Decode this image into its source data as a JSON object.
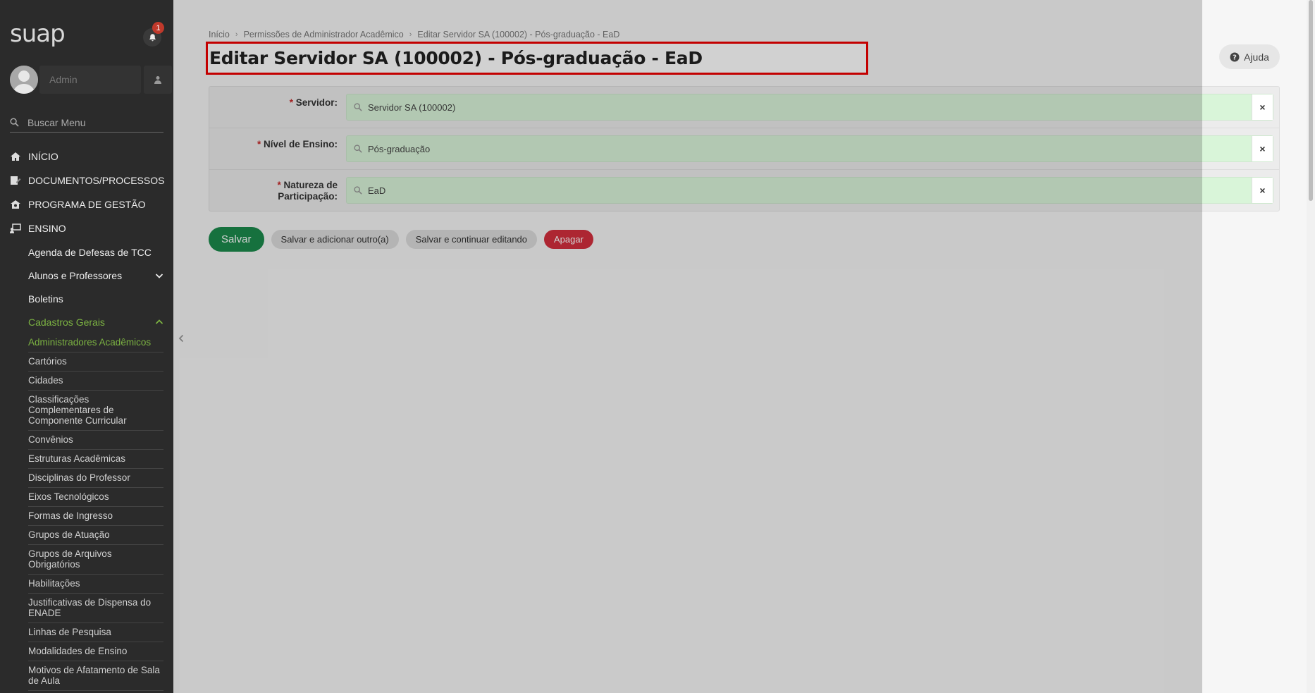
{
  "sidebar": {
    "logo": "suap",
    "notification_count": "1",
    "user_name": "Admin",
    "search_placeholder": "Buscar Menu",
    "top_items": [
      {
        "label": "INÍCIO",
        "icon": "home-icon"
      },
      {
        "label": "DOCUMENTOS/PROCESSOS",
        "icon": "document-edit-icon"
      },
      {
        "label": "PROGRAMA DE GESTÃO",
        "icon": "management-icon"
      },
      {
        "label": "ENSINO",
        "icon": "teaching-icon"
      }
    ],
    "ensino_items": [
      "Agenda de Defesas de TCC",
      "Alunos e Professores",
      "Boletins",
      "Cadastros Gerais"
    ],
    "cadastros_items": [
      "Administradores Acadêmicos",
      "Cartórios",
      "Cidades",
      "Classificações Complementares de Componente Curricular",
      "Convênios",
      "Estruturas Acadêmicas",
      "Disciplinas do Professor",
      "Eixos Tecnológicos",
      "Formas de Ingresso",
      "Grupos de Atuação",
      "Grupos de Arquivos Obrigatórios",
      "Habilitações",
      "Justificativas de Dispensa do ENADE",
      "Linhas de Pesquisa",
      "Modalidades de Ensino",
      "Motivos de Afatamento de Sala de Aula"
    ]
  },
  "breadcrumb": [
    "Início",
    "Permissões de Administrador Acadêmico",
    "Editar Servidor SA (100002) - Pós-graduação - EaD"
  ],
  "page_title": "Editar Servidor SA (100002) - Pós-graduação - EaD",
  "help_label": "Ajuda",
  "form": {
    "required_mark": "*",
    "servidor_label": "Servidor:",
    "servidor_value": "Servidor SA (100002)",
    "nivel_label": "Nível de Ensino:",
    "nivel_value": "Pós-graduação",
    "natureza_label_1": "Natureza de",
    "natureza_label_2": "Participação:",
    "natureza_value": "EaD",
    "clear_symbol": "×"
  },
  "actions": {
    "save": "Salvar",
    "save_add": "Salvar e adicionar outro(a)",
    "save_continue": "Salvar e continuar editando",
    "delete": "Apagar"
  },
  "colors": {
    "accent_green": "#1b8a4c",
    "active_menu": "#7cb342",
    "danger": "#d32f3e",
    "highlight_border": "#e00"
  }
}
